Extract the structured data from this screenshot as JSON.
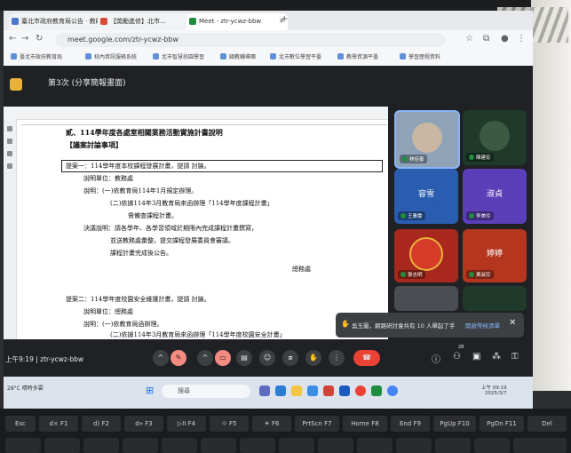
{
  "browser": {
    "tabs": [
      {
        "label": "臺北市政府教育局公告 · 教師",
        "fav": "#4a78c9"
      },
      {
        "label": "【獎勵進修】北市...",
        "fav": "#d94a3a"
      },
      {
        "label": "Meet - ztr-ycwz-bbw",
        "fav": "#1e8e3e"
      }
    ],
    "url": "meet.google.com/ztr-ycwz-bbw",
    "bookmarks": [
      "臺北市政府教育局",
      "校內資訊服務系統",
      "北市智慧校園學習",
      "國教輔導團",
      "北市數位學習平臺",
      "教學資源平臺",
      "學習歷程資料"
    ]
  },
  "meeting": {
    "title": "第3次 (分享簡報畫面)",
    "clock": "上午9:19",
    "code": "ztr-ycwz-bbw",
    "participant_count": "28"
  },
  "document": {
    "lines": [
      {
        "text": "貳、114學年度各處室相關業務活動實施計畫說明",
        "style": "h"
      },
      {
        "text": "【議案討論事項】",
        "style": "h"
      },
      {
        "text": "提案一：114學年度本校課程發展計畫，提請  討論。",
        "style": "n"
      },
      {
        "text": "說明單位：教務處",
        "style": "n"
      },
      {
        "text": "說明：(一)依教育局114年1月規定辦理。",
        "style": "n"
      },
      {
        "text": "(二)依據114年3月教育局來函辦理「114學年度課程計畫」",
        "style": "n"
      },
      {
        "text": "需備查課程計畫。",
        "style": "n"
      },
      {
        "text": "決議說明：請各學年、各學習領域於期限內完成課程計畫撰寫，",
        "style": "n"
      },
      {
        "text": "並送教務處彙整，提交課程發展委員會審議。",
        "style": "n"
      },
      {
        "text": "課程計畫完成後公告。",
        "style": "n"
      },
      {
        "text": "總務處",
        "style": "n"
      },
      {
        "text": "提案二：114學年度校園安全維護計畫，提請  討論。",
        "style": "n"
      },
      {
        "text": "說明單位：總務處",
        "style": "n"
      },
      {
        "text": "說明：(一)依教育局函辦理。",
        "style": "n"
      },
      {
        "text": "(二)依據114年3月教育局來函辦理「114學年度校園安全計畫」",
        "style": "n"
      }
    ]
  },
  "participants": [
    {
      "name": "林佳蓁",
      "initial": "",
      "bg": "#8fa3b8"
    },
    {
      "name": "陳建宏",
      "initial": "",
      "bg": "#1f3a2a"
    },
    {
      "name": "王雅雯",
      "initial": "容雪",
      "bg": "#2a5db0"
    },
    {
      "name": "李美玲",
      "initial": "淑貞",
      "bg": "#5b3fb8"
    },
    {
      "name": "張志明",
      "initial": "",
      "bg": "#a8281e"
    },
    {
      "name": "黃淑芬",
      "initial": "婷婷",
      "bg": "#b5361f"
    }
  ],
  "toast": {
    "text": "吳玉蘭，網路研討會共有 10 人舉起了手",
    "link": "開啟等候清單"
  },
  "taskbar": {
    "weather": "28°C 晴時多雲",
    "search": "搜尋",
    "time": "上午 09:19",
    "date": "2025/3/7"
  },
  "keyboard": [
    "Esc",
    "d× F1",
    "d) F2",
    "d» F3",
    "▷II F4",
    "☼ F5",
    "☀ F6",
    "PrtScn F7",
    "Home F8",
    "End F9",
    "PgUp F10",
    "PgDn F11",
    "Del"
  ]
}
